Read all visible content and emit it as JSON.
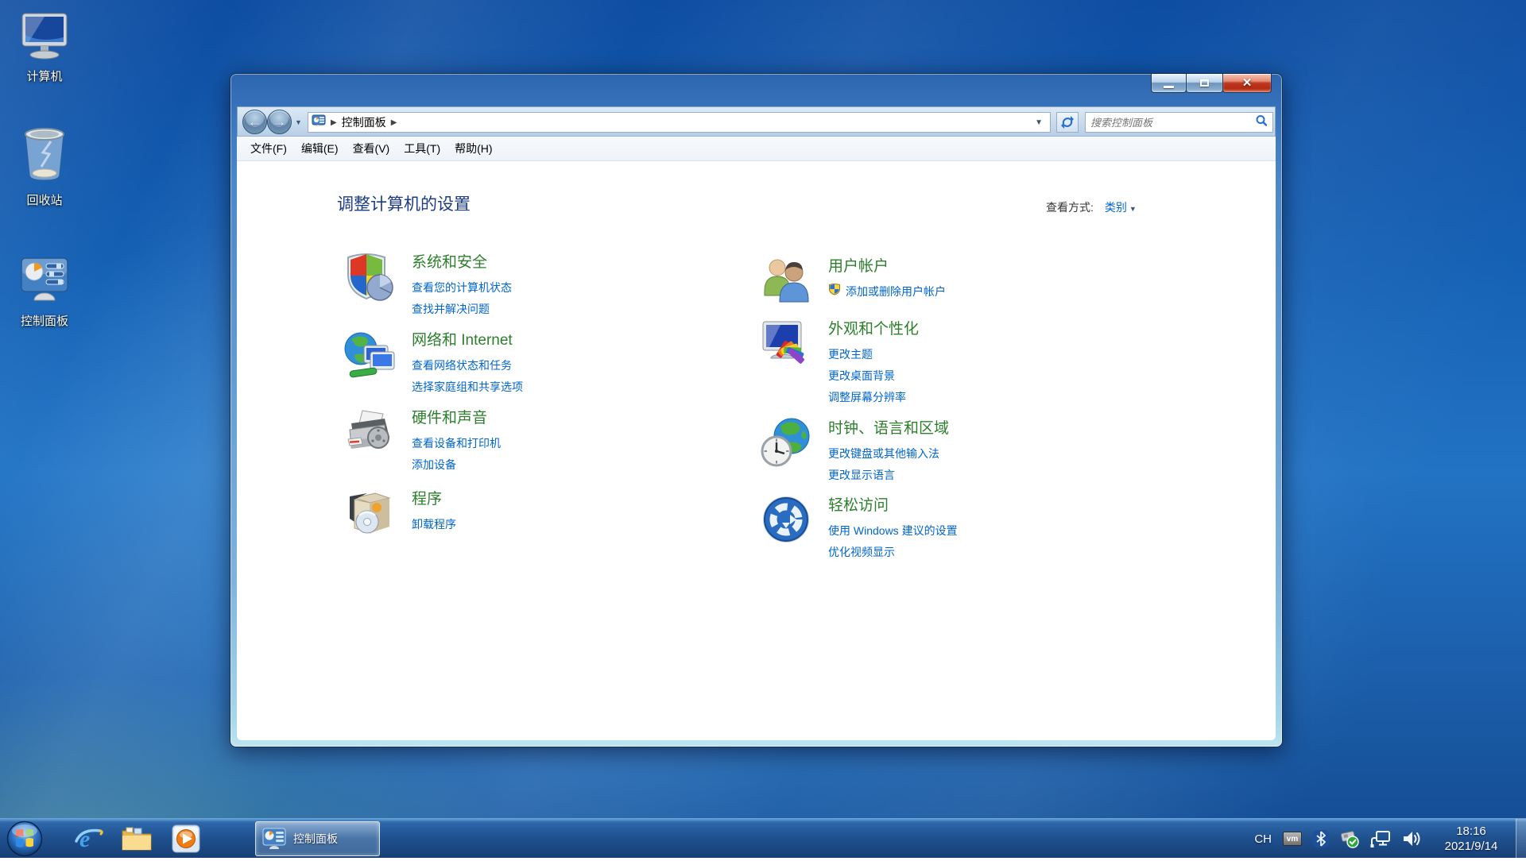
{
  "desktop": {
    "icons": [
      {
        "label": "计算机"
      },
      {
        "label": "回收站"
      },
      {
        "label": "控制面板"
      }
    ]
  },
  "window": {
    "toolbar": {
      "breadcrumb_root": "控制面板",
      "search_placeholder": "搜索控制面板"
    },
    "menu": [
      "文件(F)",
      "编辑(E)",
      "查看(V)",
      "工具(T)",
      "帮助(H)"
    ],
    "header": {
      "title": "调整计算机的设置",
      "view_by_label": "查看方式:",
      "view_by_value": "类别"
    },
    "categories": [
      {
        "icon": "system-security-icon",
        "title": "系统和安全",
        "links": [
          "查看您的计算机状态",
          "查找并解决问题"
        ]
      },
      {
        "icon": "network-internet-icon",
        "title": "网络和 Internet",
        "links": [
          "查看网络状态和任务",
          "选择家庭组和共享选项"
        ]
      },
      {
        "icon": "hardware-sound-icon",
        "title": "硬件和声音",
        "links": [
          "查看设备和打印机",
          "添加设备"
        ]
      },
      {
        "icon": "programs-icon",
        "title": "程序",
        "links": [
          "卸载程序"
        ]
      },
      {
        "icon": "user-accounts-icon",
        "title": "用户帐户",
        "links": [
          "添加或删除用户帐户"
        ]
      },
      {
        "icon": "appearance-personalization-icon",
        "title": "外观和个性化",
        "links": [
          "更改主题",
          "更改桌面背景",
          "调整屏幕分辨率"
        ]
      },
      {
        "icon": "clock-language-region-icon",
        "title": "时钟、语言和区域",
        "links": [
          "更改键盘或其他输入法",
          "更改显示语言"
        ]
      },
      {
        "icon": "ease-of-access-icon",
        "title": "轻松访问",
        "links": [
          "使用 Windows 建议的设置",
          "优化视频显示"
        ]
      }
    ]
  },
  "taskbar": {
    "active_task_label": "控制面板",
    "tray": {
      "language": "CH",
      "vm_label": "vm",
      "time": "18:16",
      "date": "2021/9/14"
    }
  },
  "colors": {
    "category_green": "#2c7f2c",
    "link_blue": "#0066cc",
    "title_navy": "#1c3c85",
    "close_red": "#c1371e"
  }
}
